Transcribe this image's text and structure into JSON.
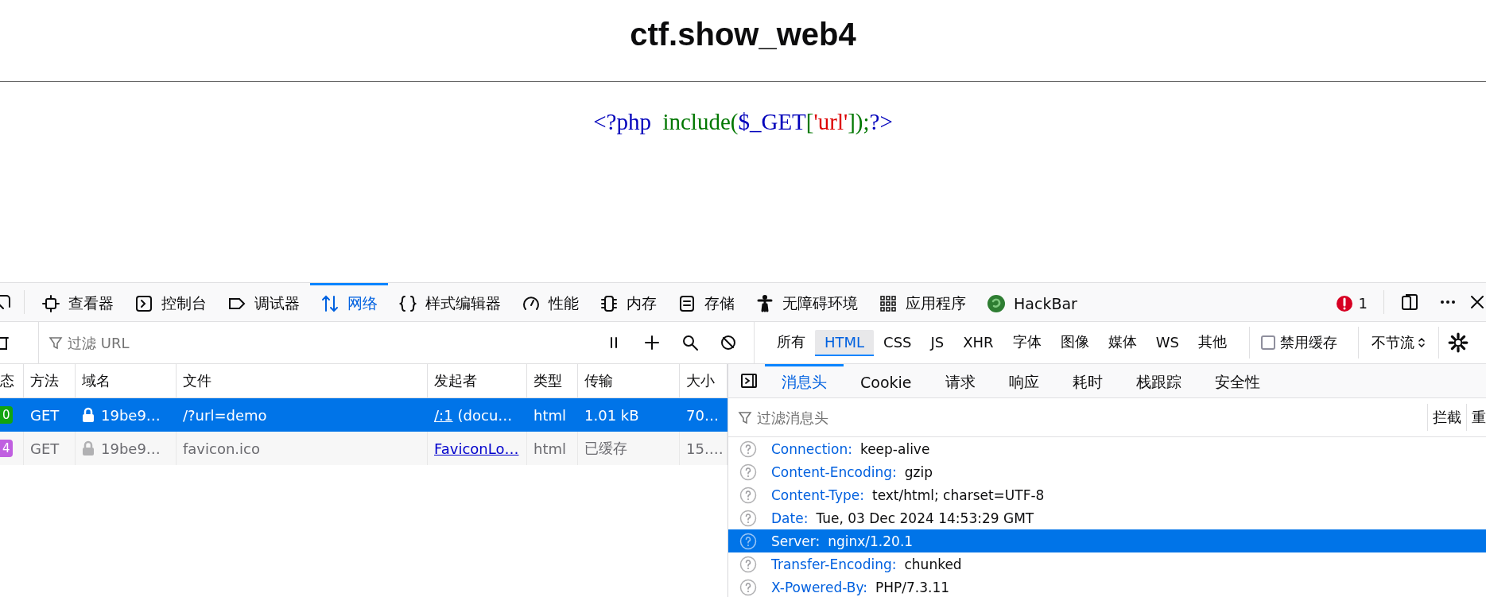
{
  "page": {
    "title": "ctf.show_web4",
    "code": [
      {
        "text": "<?php  ",
        "kind": "keyword"
      },
      {
        "text": "include(",
        "kind": "default"
      },
      {
        "text": "$_GET",
        "kind": "keyword"
      },
      {
        "text": "[",
        "kind": "default"
      },
      {
        "text": "'url'",
        "kind": "string"
      },
      {
        "text": "]);",
        "kind": "default"
      },
      {
        "text": "?>",
        "kind": "keyword"
      }
    ]
  },
  "toolbar": {
    "tools": [
      {
        "label": "查看器",
        "selected": false
      },
      {
        "label": "控制台",
        "selected": false
      },
      {
        "label": "调试器",
        "selected": false
      },
      {
        "label": "网络",
        "selected": true
      },
      {
        "label": "样式编辑器",
        "selected": false
      },
      {
        "label": "性能",
        "selected": false
      },
      {
        "label": "内存",
        "selected": false
      },
      {
        "label": "存储",
        "selected": false
      },
      {
        "label": "无障碍环境",
        "selected": false
      },
      {
        "label": "应用程序",
        "selected": false
      },
      {
        "label": "HackBar",
        "selected": false
      }
    ],
    "error_count": "1"
  },
  "filter_bar": {
    "placeholder": "过滤 URL",
    "type_filters": [
      {
        "label": "所有",
        "selected": false
      },
      {
        "label": "HTML",
        "selected": true
      },
      {
        "label": "CSS",
        "selected": false
      },
      {
        "label": "JS",
        "selected": false
      },
      {
        "label": "XHR",
        "selected": false
      },
      {
        "label": "字体",
        "selected": false
      },
      {
        "label": "图像",
        "selected": false
      },
      {
        "label": "媒体",
        "selected": false
      },
      {
        "label": "WS",
        "selected": false
      },
      {
        "label": "其他",
        "selected": false
      }
    ],
    "disable_cache": {
      "label": "禁用缓存",
      "checked": false
    },
    "throttle": "不节流"
  },
  "requests": {
    "columns": [
      "态",
      "方法",
      "域名",
      "文件",
      "发起者",
      "类型",
      "传输",
      "大小"
    ],
    "rows": [
      {
        "status": "0",
        "color": "#12a40f",
        "method": "GET",
        "domain": "19be9…",
        "file": "/?url=demo",
        "initiator_link": "/:1",
        "initiator_rest": "(docu…",
        "type": "html",
        "transfer": "1.01 kB",
        "size": "70…",
        "selected": true,
        "cached": false
      },
      {
        "status": "4",
        "color": "#c05fe0",
        "method": "GET",
        "domain": "19be9…",
        "file": "favicon.ico",
        "initiator_link": "FaviconLo…",
        "type": "html",
        "transfer": "已缓存",
        "size": "15.…",
        "selected": false,
        "cached": true
      }
    ]
  },
  "details": {
    "tabs": [
      {
        "label": "消息头",
        "selected": true
      },
      {
        "label": "Cookie",
        "selected": false
      },
      {
        "label": "请求",
        "selected": false
      },
      {
        "label": "响应",
        "selected": false
      },
      {
        "label": "耗时",
        "selected": false
      },
      {
        "label": "栈跟踪",
        "selected": false
      },
      {
        "label": "安全性",
        "selected": false
      }
    ],
    "filter_placeholder": "过滤消息头",
    "buttons": [
      "拦截",
      "重"
    ],
    "headers": [
      {
        "name": "Connection:",
        "value": "keep-alive",
        "selected": false
      },
      {
        "name": "Content-Encoding:",
        "value": "gzip",
        "selected": false
      },
      {
        "name": "Content-Type:",
        "value": "text/html; charset=UTF-8",
        "selected": false
      },
      {
        "name": "Date:",
        "value": "Tue, 03 Dec 2024 14:53:29 GMT",
        "selected": false
      },
      {
        "name": "Server:",
        "value": "nginx/1.20.1",
        "selected": true
      },
      {
        "name": "Transfer-Encoding:",
        "value": "chunked",
        "selected": false
      },
      {
        "name": "X-Powered-By:",
        "value": "PHP/7.3.11",
        "selected": false
      }
    ]
  }
}
